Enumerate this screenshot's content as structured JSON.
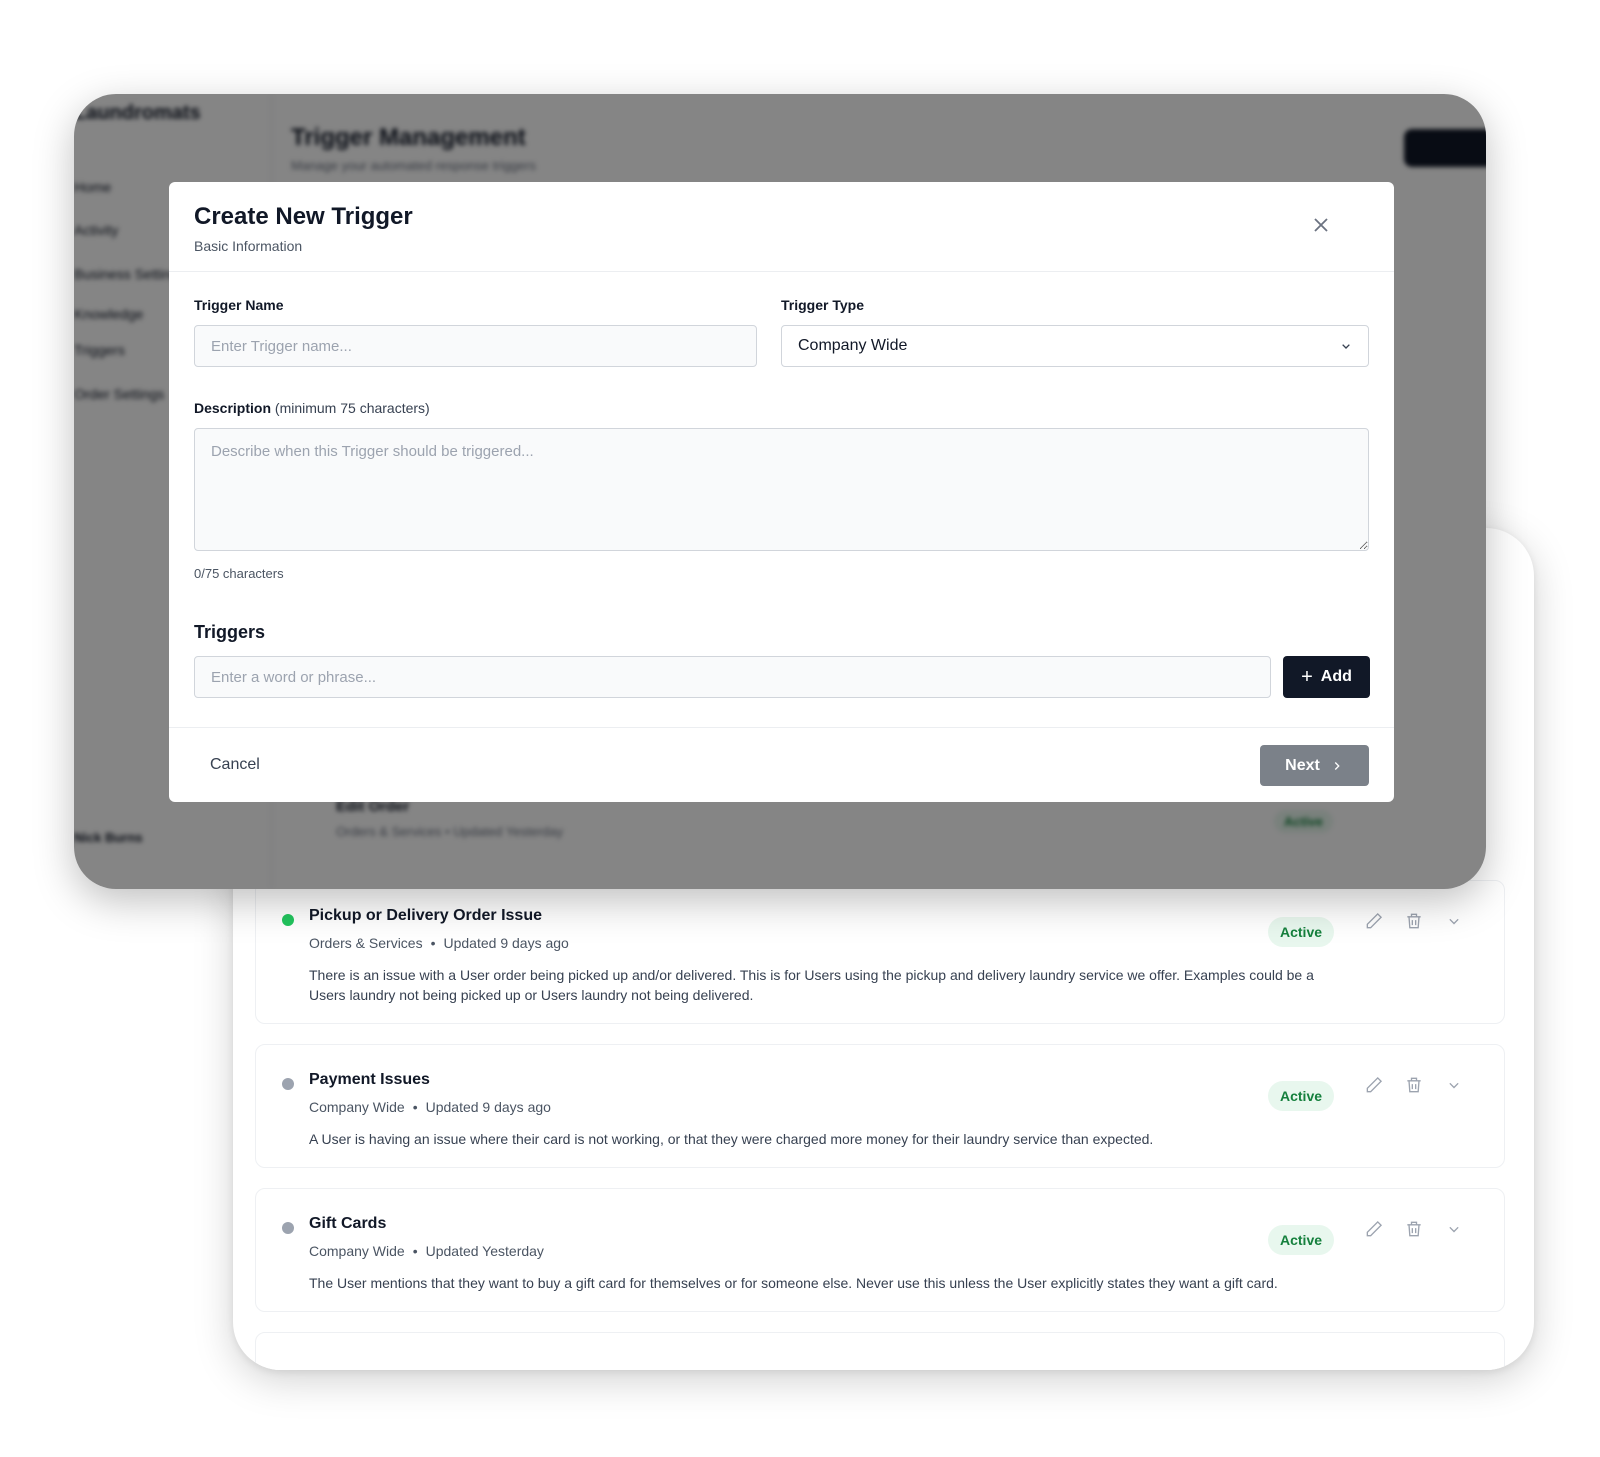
{
  "background_app": {
    "company_name": "Laundromats",
    "page_title": "Trigger Management",
    "page_subtitle": "Manage your automated response triggers",
    "sidebar_items": [
      "Home",
      "Activity",
      "Business Settings",
      "Knowledge",
      "Triggers",
      "Order Settings"
    ],
    "user_name": "Nick Burns",
    "partial_item": {
      "title": "Edit Order",
      "meta": "Orders & Services • Updated Yesterday",
      "badge": "Active"
    }
  },
  "modal": {
    "title": "Create New Trigger",
    "subtitle": "Basic Information",
    "trigger_name_label": "Trigger Name",
    "trigger_name_placeholder": "Enter Trigger name...",
    "trigger_type_label": "Trigger Type",
    "trigger_type_value": "Company Wide",
    "description_label": "Description",
    "description_hint": "(minimum 75 characters)",
    "description_placeholder": "Describe when this Trigger should be triggered...",
    "char_count": "0/75 characters",
    "triggers_heading": "Triggers",
    "triggers_placeholder": "Enter a word or phrase...",
    "add_label": "Add",
    "cancel_label": "Cancel",
    "next_label": "Next"
  },
  "trigger_list": [
    {
      "title": "Pickup or Delivery Order Issue",
      "category": "Orders & Services",
      "updated": "Updated 9 days ago",
      "description": "There is an issue with a User order being picked up and/or delivered. This is for Users using the pickup and delivery laundry service we offer. Examples could be a Users laundry not being picked up or Users laundry not being delivered.",
      "status": "Active",
      "dot_color": "#22c55e"
    },
    {
      "title": "Payment Issues",
      "category": "Company Wide",
      "updated": "Updated 9 days ago",
      "description": "A User is having an issue where their card is not working, or that they were charged more money for their laundry service than expected.",
      "status": "Active",
      "dot_color": "#9ca3af"
    },
    {
      "title": "Gift Cards",
      "category": "Company Wide",
      "updated": "Updated Yesterday",
      "description": "The User mentions that they want to buy a gift card for themselves or for someone else. Never use this unless the User explicitly states they want a gift card.",
      "status": "Active",
      "dot_color": "#9ca3af"
    }
  ],
  "colors": {
    "primary": "#111827",
    "badge_bg": "#e8f7ee",
    "badge_text": "#15803d",
    "next_disabled": "#7b8189"
  }
}
